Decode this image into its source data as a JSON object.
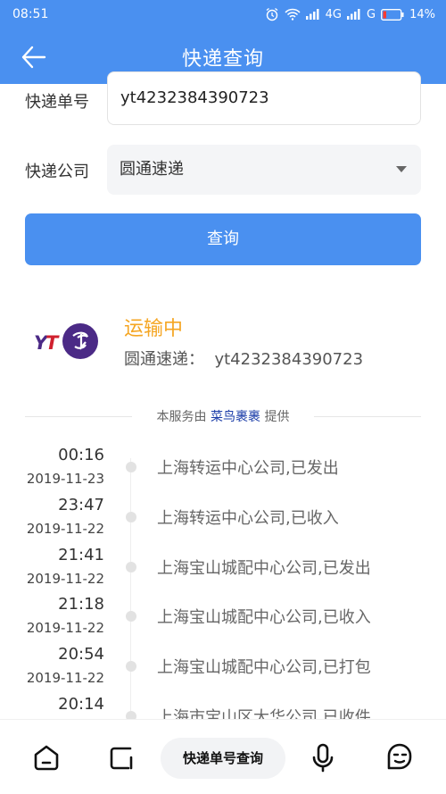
{
  "status_bar": {
    "time": "08:51",
    "network_label_1": "4G",
    "network_label_2": "G",
    "battery": "14%"
  },
  "app_bar": {
    "title": "快递查询",
    "back_icon": "arrow-left-icon"
  },
  "form": {
    "tracking_label": "快递单号",
    "tracking_value": "yt4232384390723",
    "company_label": "快递公司",
    "company_value": "圆通速递",
    "query_button": "查询"
  },
  "result": {
    "logo_text": "YT",
    "status": "运输中",
    "carrier_prefix": "圆通速递：",
    "tracking_number": "yt4232384390723"
  },
  "provider": {
    "prefix": "本服务由",
    "name": "菜鸟裹裹",
    "suffix": "提供"
  },
  "events": [
    {
      "time": "00:16",
      "date": "2019-11-23",
      "desc": "上海转运中心公司,已发出"
    },
    {
      "time": "23:47",
      "date": "2019-11-22",
      "desc": "上海转运中心公司,已收入"
    },
    {
      "time": "21:41",
      "date": "2019-11-22",
      "desc": "上海宝山城配中心公司,已发出"
    },
    {
      "time": "21:18",
      "date": "2019-11-22",
      "desc": "上海宝山城配中心公司,已收入"
    },
    {
      "time": "20:54",
      "date": "2019-11-22",
      "desc": "上海宝山城配中心公司,已打包"
    },
    {
      "time": "20:14",
      "date": "",
      "desc": "上海市宝山区大华公司,已收件"
    }
  ],
  "bottom_nav": {
    "pill_label": "快递单号查询",
    "icons": [
      "home-icon",
      "square-icon",
      "microphone-icon",
      "assistant-face-icon"
    ]
  },
  "colors": {
    "primary": "#4a90f0",
    "status_orange": "#f5a623",
    "logo_purple": "#4b2a86",
    "logo_red": "#d0202e"
  }
}
